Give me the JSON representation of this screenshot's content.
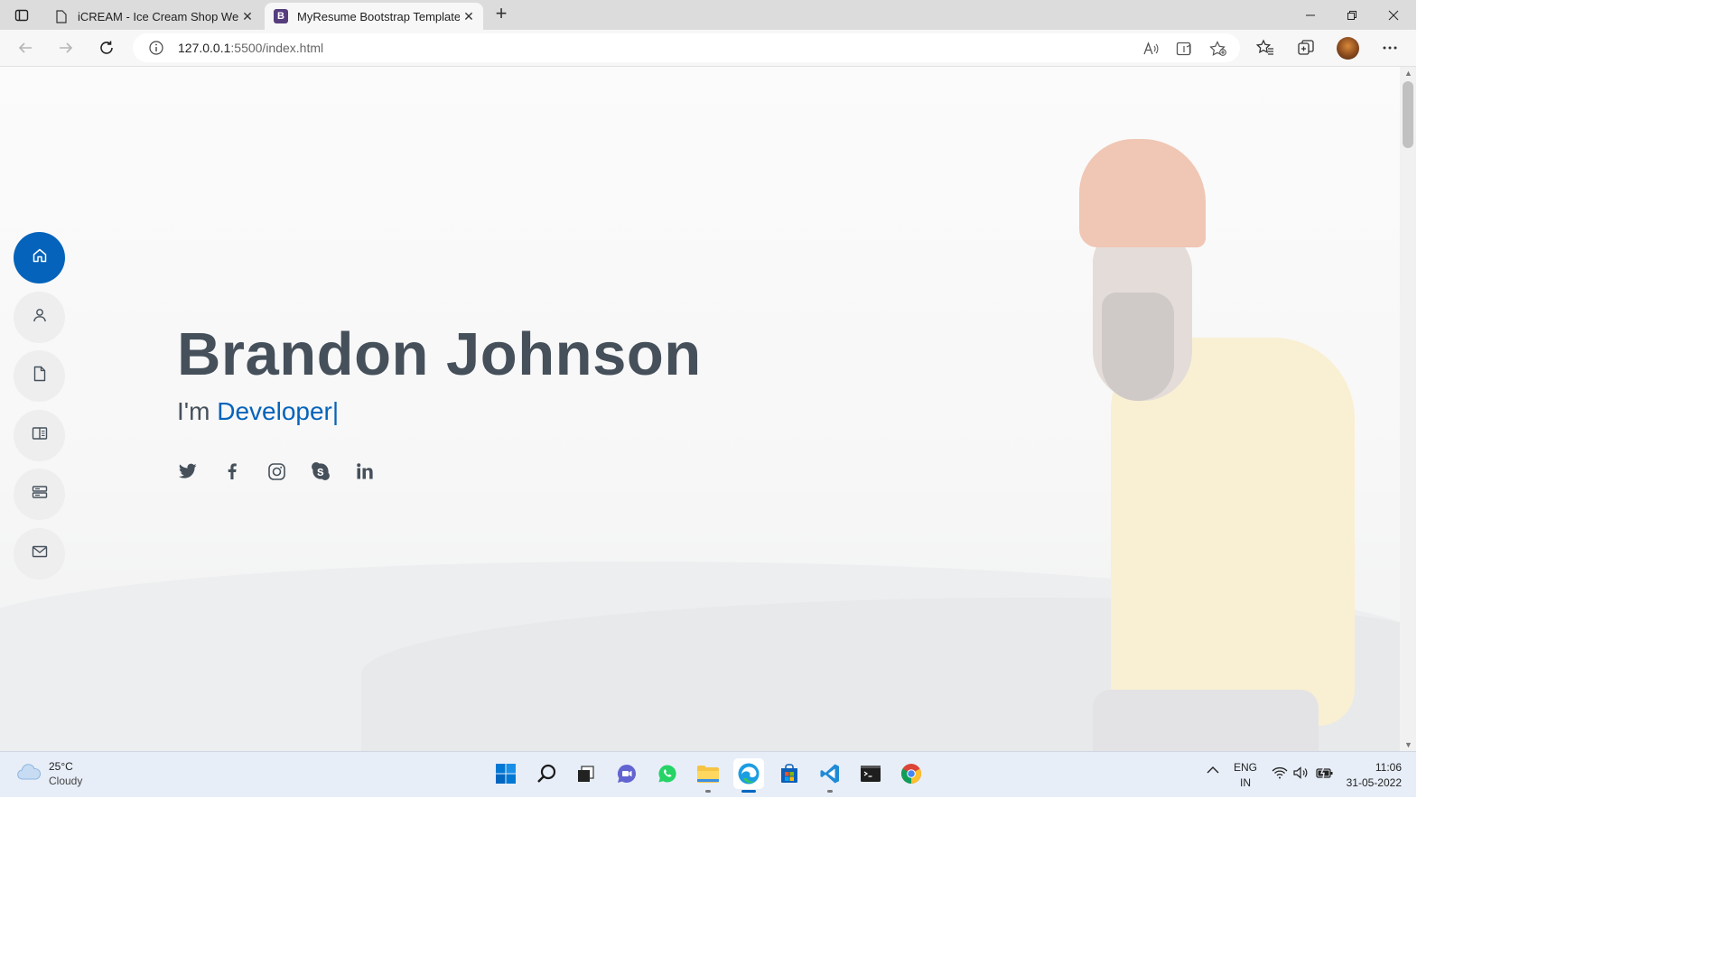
{
  "browser": {
    "tabs": [
      {
        "title": "iCREAM - Ice Cream Shop Websi",
        "active": false
      },
      {
        "title": "MyResume Bootstrap Template -",
        "active": true
      }
    ],
    "favicon_letter": "B",
    "url_host": "127.0.0.1",
    "url_rest": ":5500/index.html"
  },
  "page": {
    "name": "Brandon Johnson",
    "subtitle_prefix": "I'm ",
    "typed_role": "Developer",
    "cursor": "|",
    "nav": [
      "home-icon",
      "person-icon",
      "file-icon",
      "book-icon",
      "server-icon",
      "envelope-icon"
    ],
    "socials": [
      "twitter-icon",
      "facebook-icon",
      "instagram-icon",
      "skype-icon",
      "linkedin-icon"
    ],
    "accent_color": "#0563bb",
    "text_color": "#45505b"
  },
  "taskbar": {
    "weather_temp": "25°C",
    "weather_desc": "Cloudy",
    "lang_top": "ENG",
    "lang_bottom": "IN",
    "time": "11:06",
    "date": "31-05-2022"
  }
}
